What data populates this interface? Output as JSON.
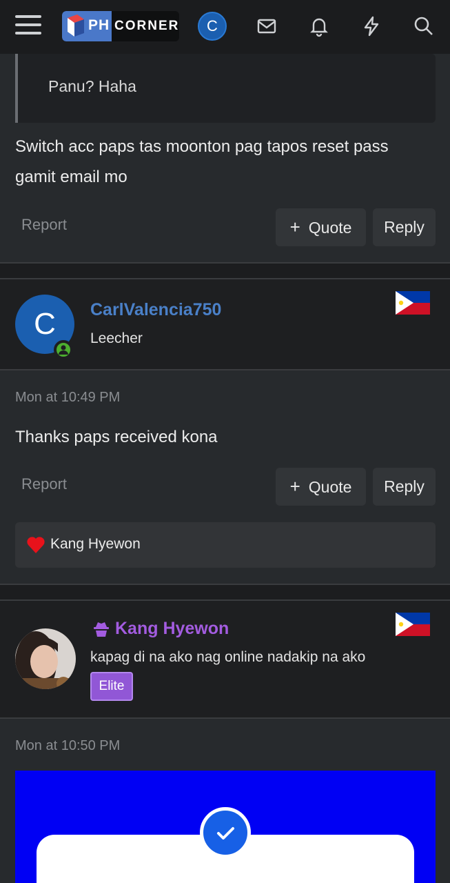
{
  "header": {
    "logo_ph": "PH",
    "logo_corner": "CORNER",
    "avatar_letter": "C",
    "icons": [
      "menu-icon",
      "mail-icon",
      "bell-icon",
      "bolt-icon",
      "search-icon"
    ]
  },
  "post1": {
    "quote_text": "Panu? Haha",
    "message": "Switch acc paps tas moonton pag tapos reset pass gamit email mo",
    "report_label": "Report",
    "quote_label": "Quote",
    "reply_label": "Reply"
  },
  "post2": {
    "avatar_letter": "C",
    "username": "CarlValencia750",
    "user_title": "Leecher",
    "timestamp": "Mon at 10:49 PM",
    "message": "Thanks paps received kona",
    "report_label": "Report",
    "quote_label": "Quote",
    "reply_label": "Reply",
    "reaction_user": "Kang Hyewon"
  },
  "post3": {
    "username": "Kang Hyewon",
    "user_title": "kapag di na ako nag online nadakip na ako",
    "badge": "Elite",
    "timestamp": "Mon at 10:50 PM"
  },
  "colors": {
    "link_blue": "#4a80c8",
    "elite_purple": "#a35ce0",
    "attachment_blue": "#0000f4"
  }
}
